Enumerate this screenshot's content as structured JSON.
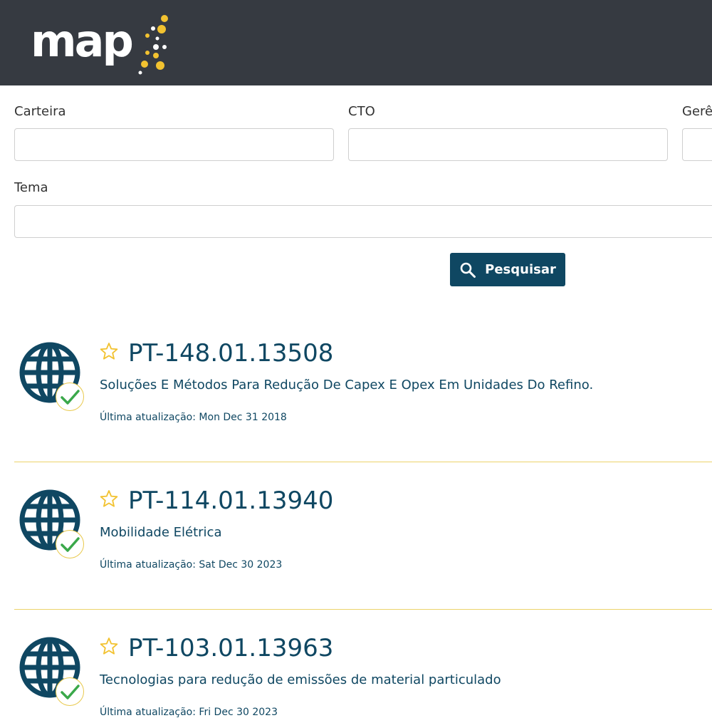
{
  "header": {
    "logo_text": "map"
  },
  "filters": {
    "carteira_label": "Carteira",
    "cto_label": "CTO",
    "gerencia_label": "Gerê",
    "tema_label": "Tema",
    "carteira_value": "",
    "cto_value": "",
    "gerencia_value": "",
    "tema_value": ""
  },
  "search": {
    "button_label": "Pesquisar"
  },
  "colors": {
    "header_bg": "#363a41",
    "accent": "#0f4762",
    "star": "#f2c230",
    "check": "#3aa84a",
    "divider": "#ecd36a"
  },
  "results": [
    {
      "code": "PT-148.01.13508",
      "description": "Soluções E Métodos Para Redução De Capex E Opex Em Unidades Do Refino.",
      "updated": "Última atualização: Mon Dec 31 2018",
      "icon": "globe-icon",
      "status_icon": "check-icon"
    },
    {
      "code": "PT-114.01.13940",
      "description": "Mobilidade Elétrica",
      "updated": "Última atualização: Sat Dec 30 2023",
      "icon": "globe-icon",
      "status_icon": "check-icon"
    },
    {
      "code": "PT-103.01.13963",
      "description": "Tecnologias para redução de emissões de material particulado",
      "updated": "Última atualização: Fri Dec 30 2023",
      "icon": "globe-icon",
      "status_icon": "check-icon"
    }
  ]
}
